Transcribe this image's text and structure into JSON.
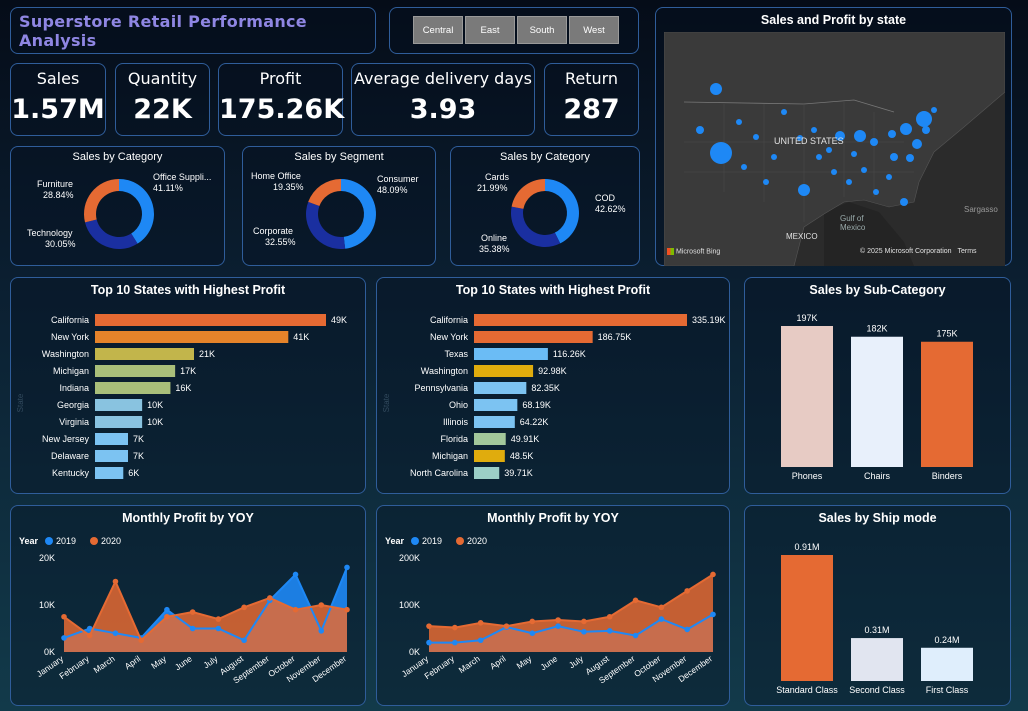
{
  "title": "Superstore Retail Performance Analysis",
  "regions": [
    "Central",
    "East",
    "South",
    "West"
  ],
  "kpis": [
    {
      "label": "Sales",
      "value": "1.57M"
    },
    {
      "label": "Quantity",
      "value": "22K"
    },
    {
      "label": "Profit",
      "value": "175.26K"
    },
    {
      "label": "Average delivery days",
      "value": "3.93"
    },
    {
      "label": "Return",
      "value": "287"
    }
  ],
  "colors": {
    "blue": "#1e88f5",
    "navy": "#1a2fa0",
    "orange": "#e56a33"
  },
  "map": {
    "title": "Sales and Profit by state",
    "country_label": "UNITED STATES",
    "gulf_label": "Gulf of Mexico",
    "mexico_label": "MEXICO",
    "sargasso_label": "Sargasso",
    "bing_label": "Microsoft Bing",
    "copyright": "© 2025 Microsoft Corporation",
    "terms": "Terms"
  },
  "donut_category": {
    "title": "Sales by Category",
    "chart_data": {
      "type": "pie",
      "title": "Sales by Category",
      "slices": [
        {
          "label": "Office Suppli...",
          "value": 41.11,
          "pct": "41.11%",
          "color": "#1e88f5"
        },
        {
          "label": "Technology",
          "value": 30.05,
          "pct": "30.05%",
          "color": "#1a2fa0"
        },
        {
          "label": "Furniture",
          "value": 28.84,
          "pct": "28.84%",
          "color": "#e56a33"
        }
      ]
    }
  },
  "donut_segment": {
    "title": "Sales by Segment",
    "chart_data": {
      "type": "pie",
      "title": "Sales by Segment",
      "slices": [
        {
          "label": "Consumer",
          "value": 48.09,
          "pct": "48.09%",
          "color": "#1e88f5"
        },
        {
          "label": "Corporate",
          "value": 32.55,
          "pct": "32.55%",
          "color": "#1a2fa0"
        },
        {
          "label": "Home Office",
          "value": 19.35,
          "pct": "19.35%",
          "color": "#e56a33"
        }
      ]
    }
  },
  "donut_payment": {
    "title": "Sales by Category",
    "chart_data": {
      "type": "pie",
      "title": "Sales by Category",
      "slices": [
        {
          "label": "COD",
          "value": 42.62,
          "pct": "42.62%",
          "color": "#1e88f5"
        },
        {
          "label": "Online",
          "value": 35.38,
          "pct": "35.38%",
          "color": "#1a2fa0"
        },
        {
          "label": "Cards",
          "value": 21.99,
          "pct": "21.99%",
          "color": "#e56a33"
        }
      ]
    }
  },
  "top_states_1": {
    "title": "Top 10 States with Highest Profit",
    "axis_label": "State",
    "chart_data": {
      "type": "bar",
      "orientation": "horizontal",
      "title": "Top 10 States with Highest Profit",
      "categories": [
        "California",
        "New York",
        "Washington",
        "Michigan",
        "Indiana",
        "Georgia",
        "Virginia",
        "New Jersey",
        "Delaware",
        "Kentucky"
      ],
      "values": [
        49000,
        41000,
        21000,
        17000,
        16000,
        10000,
        10000,
        7000,
        7000,
        6000
      ],
      "labels": [
        "49K",
        "41K",
        "21K",
        "17K",
        "16K",
        "10K",
        "10K",
        "7K",
        "7K",
        "6K"
      ],
      "colors": [
        "#e56a33",
        "#e5832a",
        "#c2b54b",
        "#a9bf7a",
        "#a9bf7a",
        "#89c3e0",
        "#89c3e0",
        "#7cc3f2",
        "#7cc3f2",
        "#7cc3f2"
      ],
      "xlim": [
        0,
        49000
      ]
    }
  },
  "top_states_2": {
    "title": "Top 10 States with Highest Profit",
    "axis_label": "State",
    "chart_data": {
      "type": "bar",
      "orientation": "horizontal",
      "title": "Top 10 States with Highest Profit",
      "categories": [
        "California",
        "New York",
        "Texas",
        "Washington",
        "Pennsylvania",
        "Ohio",
        "Illinois",
        "Florida",
        "Michigan",
        "North Carolina"
      ],
      "values": [
        335190,
        186750,
        116260,
        92980,
        82350,
        68190,
        64220,
        49910,
        48500,
        39710
      ],
      "labels": [
        "335.19K",
        "186.75K",
        "116.26K",
        "92.98K",
        "82.35K",
        "68.19K",
        "64.22K",
        "49.91K",
        "48.5K",
        "39.71K"
      ],
      "colors": [
        "#e56a33",
        "#e56a33",
        "#6bbcf5",
        "#e0ac0d",
        "#7cc3f2",
        "#7cc3f2",
        "#7cc3f2",
        "#a2c79a",
        "#e0ac0d",
        "#9ccfc7"
      ],
      "xlim": [
        0,
        335190
      ]
    }
  },
  "subcategory": {
    "title": "Sales by Sub-Category",
    "chart_data": {
      "type": "bar",
      "title": "Sales by Sub-Category",
      "categories": [
        "Phones",
        "Chairs",
        "Binders"
      ],
      "values": [
        197000,
        182000,
        175000
      ],
      "labels": [
        "197K",
        "182K",
        "175K"
      ],
      "colors": [
        "#e7cbc4",
        "#e8f0fb",
        "#e56a33"
      ],
      "ylim": [
        0,
        197000
      ]
    }
  },
  "shipmode": {
    "title": "Sales by Ship mode",
    "chart_data": {
      "type": "bar",
      "title": "Sales by Ship mode",
      "categories": [
        "Standard Class",
        "Second Class",
        "First Class"
      ],
      "values": [
        0.91,
        0.31,
        0.24
      ],
      "labels": [
        "0.91M",
        "0.31M",
        "0.24M"
      ],
      "colors": [
        "#e56a33",
        "#e1e5f0",
        "#dfeefc"
      ],
      "ylim": [
        0,
        0.91
      ]
    }
  },
  "monthly_1": {
    "title": "Monthly Profit by YOY",
    "legend_title": "Year",
    "chart_data": {
      "type": "area",
      "title": "Monthly Profit by YOY",
      "categories": [
        "January",
        "February",
        "March",
        "April",
        "May",
        "June",
        "July",
        "August",
        "September",
        "October",
        "November",
        "December"
      ],
      "series": [
        {
          "name": "2019",
          "color": "#1e88f5",
          "values": [
            3000,
            5000,
            4000,
            3000,
            9000,
            5000,
            5000,
            2500,
            11000,
            16500,
            4500,
            18000
          ]
        },
        {
          "name": "2020",
          "color": "#e56a33",
          "values": [
            7500,
            3500,
            15000,
            2500,
            7500,
            8500,
            7000,
            9500,
            11500,
            9000,
            10000,
            9000
          ]
        }
      ],
      "yticks": [
        "0K",
        "10K",
        "20K"
      ],
      "ylim": [
        0,
        20000
      ],
      "legend": "top-left"
    }
  },
  "monthly_2": {
    "title": "Monthly Profit by YOY",
    "legend_title": "Year",
    "chart_data": {
      "type": "area",
      "title": "Monthly Profit by YOY",
      "categories": [
        "January",
        "February",
        "March",
        "April",
        "May",
        "June",
        "July",
        "August",
        "September",
        "October",
        "November",
        "December"
      ],
      "series": [
        {
          "name": "2019",
          "color": "#1e88f5",
          "values": [
            20000,
            20000,
            25000,
            53000,
            40000,
            55000,
            43000,
            45000,
            35000,
            70000,
            48000,
            80000
          ]
        },
        {
          "name": "2020",
          "color": "#e56a33",
          "values": [
            55000,
            52000,
            62000,
            55000,
            65000,
            68000,
            65000,
            75000,
            110000,
            95000,
            130000,
            165000
          ]
        }
      ],
      "yticks": [
        "0K",
        "100K",
        "200K"
      ],
      "ylim": [
        0,
        200000
      ],
      "legend": "top-left"
    }
  }
}
